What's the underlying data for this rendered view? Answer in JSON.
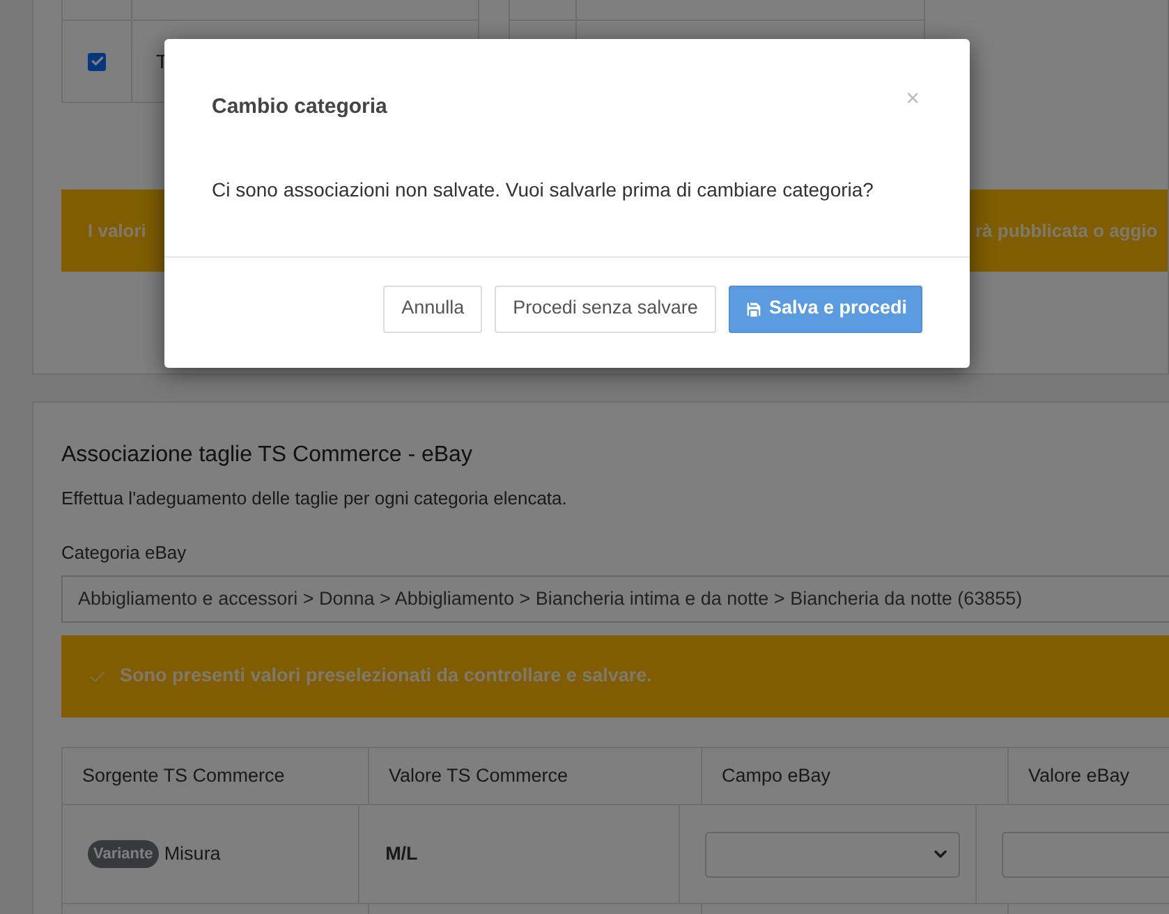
{
  "top_table": {
    "rows": [
      {
        "checked": true,
        "text": "T"
      }
    ]
  },
  "notice": {
    "text_start": "I valori",
    "text_end": "rà pubblicata o aggio"
  },
  "section": {
    "title": "Associazione taglie TS Commerce - eBay",
    "subtitle": "Effettua l'adeguamento delle taglie per ogni categoria elencata.",
    "category_label": "Categoria eBay",
    "category_value": "Abbigliamento e accessori > Donna > Abbigliamento > Biancheria intima e da notte > Biancheria da notte (63855)",
    "alert": "Sono presenti valori preselezionati da controllare e salvare.",
    "table": {
      "columns": [
        "Sorgente TS Commerce",
        "Valore TS Commerce",
        "Campo eBay",
        "Valore eBay"
      ],
      "rows": [
        {
          "badge": "Variante",
          "source": "Misura",
          "value": "M/L"
        }
      ]
    }
  },
  "dialog": {
    "title": "Cambio categoria",
    "close": "×",
    "message": "Ci sono associazioni non salvate. Vuoi salvarle prima di cambiare categoria?",
    "buttons": [
      {
        "label": "Annulla",
        "kind": "default"
      },
      {
        "label": "Procedi senza salvare",
        "kind": "default"
      },
      {
        "label": "Salva e procedi",
        "kind": "primary"
      }
    ]
  }
}
